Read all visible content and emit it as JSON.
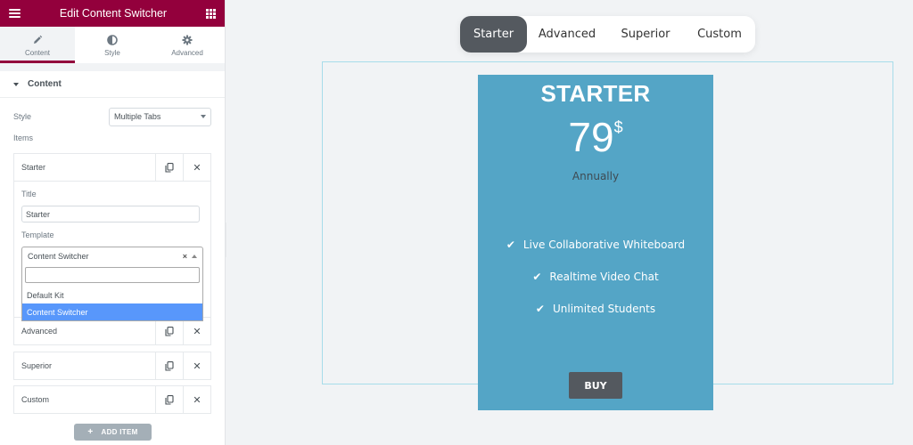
{
  "sidebar": {
    "header": {
      "title": "Edit Content Switcher",
      "menu_icon": "hamburger-icon",
      "apps_icon": "grid-icon"
    },
    "tabs": [
      {
        "label": "Content",
        "icon": "pencil-icon",
        "active": true
      },
      {
        "label": "Style",
        "icon": "half-circle-icon",
        "active": false
      },
      {
        "label": "Advanced",
        "icon": "gear-icon",
        "active": false
      }
    ],
    "section": {
      "title": "Content",
      "style_label": "Style",
      "style_value": "Multiple Tabs",
      "items_label": "Items",
      "items": [
        {
          "title": "Starter",
          "expanded": true
        },
        {
          "title": "Advanced",
          "expanded": false
        },
        {
          "title": "Superior",
          "expanded": false
        },
        {
          "title": "Custom",
          "expanded": false
        }
      ],
      "expanded_item": {
        "title_label": "Title",
        "title_value": "Starter",
        "template_label": "Template",
        "template_value": "Content Switcher",
        "clear_symbol": "×",
        "dropdown_options": [
          "Default Kit",
          "Content Switcher"
        ],
        "highlighted_option": "Content Switcher",
        "search_value": ""
      },
      "add_item_label": "ADD ITEM",
      "add_item_symbol": "+"
    },
    "collapse_symbol": "‹"
  },
  "canvas": {
    "switcher_tabs": [
      {
        "label": "Starter",
        "active": true
      },
      {
        "label": "Advanced",
        "active": false
      },
      {
        "label": "Superior",
        "active": false
      },
      {
        "label": "Custom",
        "active": false
      }
    ],
    "pricing_card": {
      "title": "STARTER",
      "price": "79",
      "currency": "$",
      "period": "Annually",
      "check_symbol": "✔",
      "features": [
        "Live Collaborative Whiteboard",
        "Realtime Video Chat",
        "Unlimited Students"
      ],
      "button_label": "BUY"
    }
  },
  "colors": {
    "brand": "#93003c",
    "card_bg": "#54a5c6",
    "active_tab": "#54595f",
    "dropdown_highlight": "#5897fb"
  }
}
